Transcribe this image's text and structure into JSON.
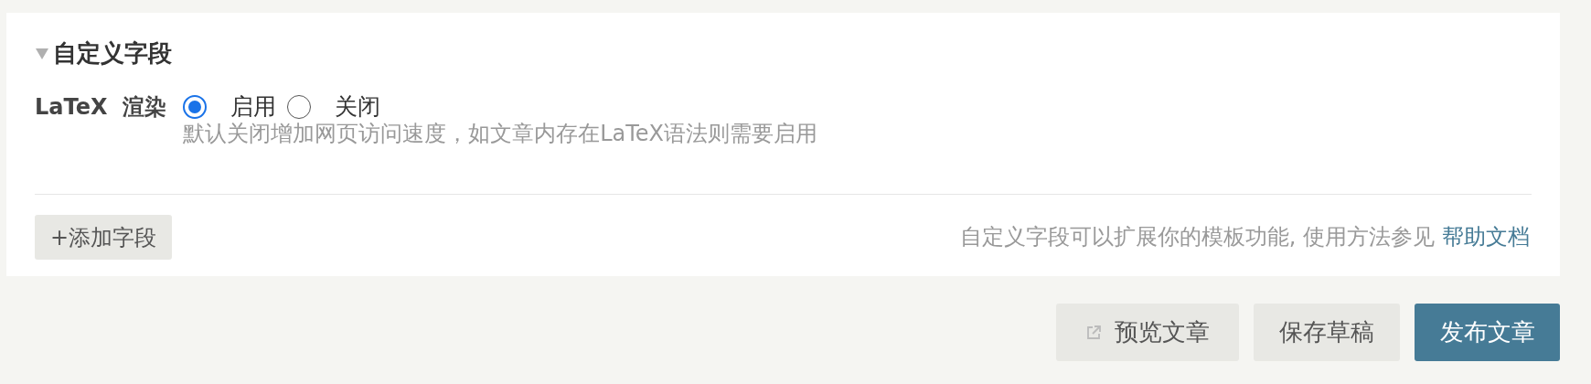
{
  "section": {
    "title": "自定义字段",
    "expanded": true,
    "fields": [
      {
        "label": "LaTeX  渲染",
        "options": [
          {
            "label": "启用",
            "selected": true
          },
          {
            "label": "关闭",
            "selected": false
          }
        ],
        "hint": "默认关闭增加网页访问速度，如文章内存在LaTeX语法则需要启用"
      }
    ],
    "add_button": "+添加字段",
    "help_text": "自定义字段可以扩展你的模板功能, 使用方法参见",
    "help_link": "帮助文档"
  },
  "actions": [
    {
      "label": "预览文章",
      "kind": "external"
    },
    {
      "label": "保存草稿",
      "kind": "secondary"
    },
    {
      "label": "发布文章",
      "kind": "primary"
    }
  ]
}
